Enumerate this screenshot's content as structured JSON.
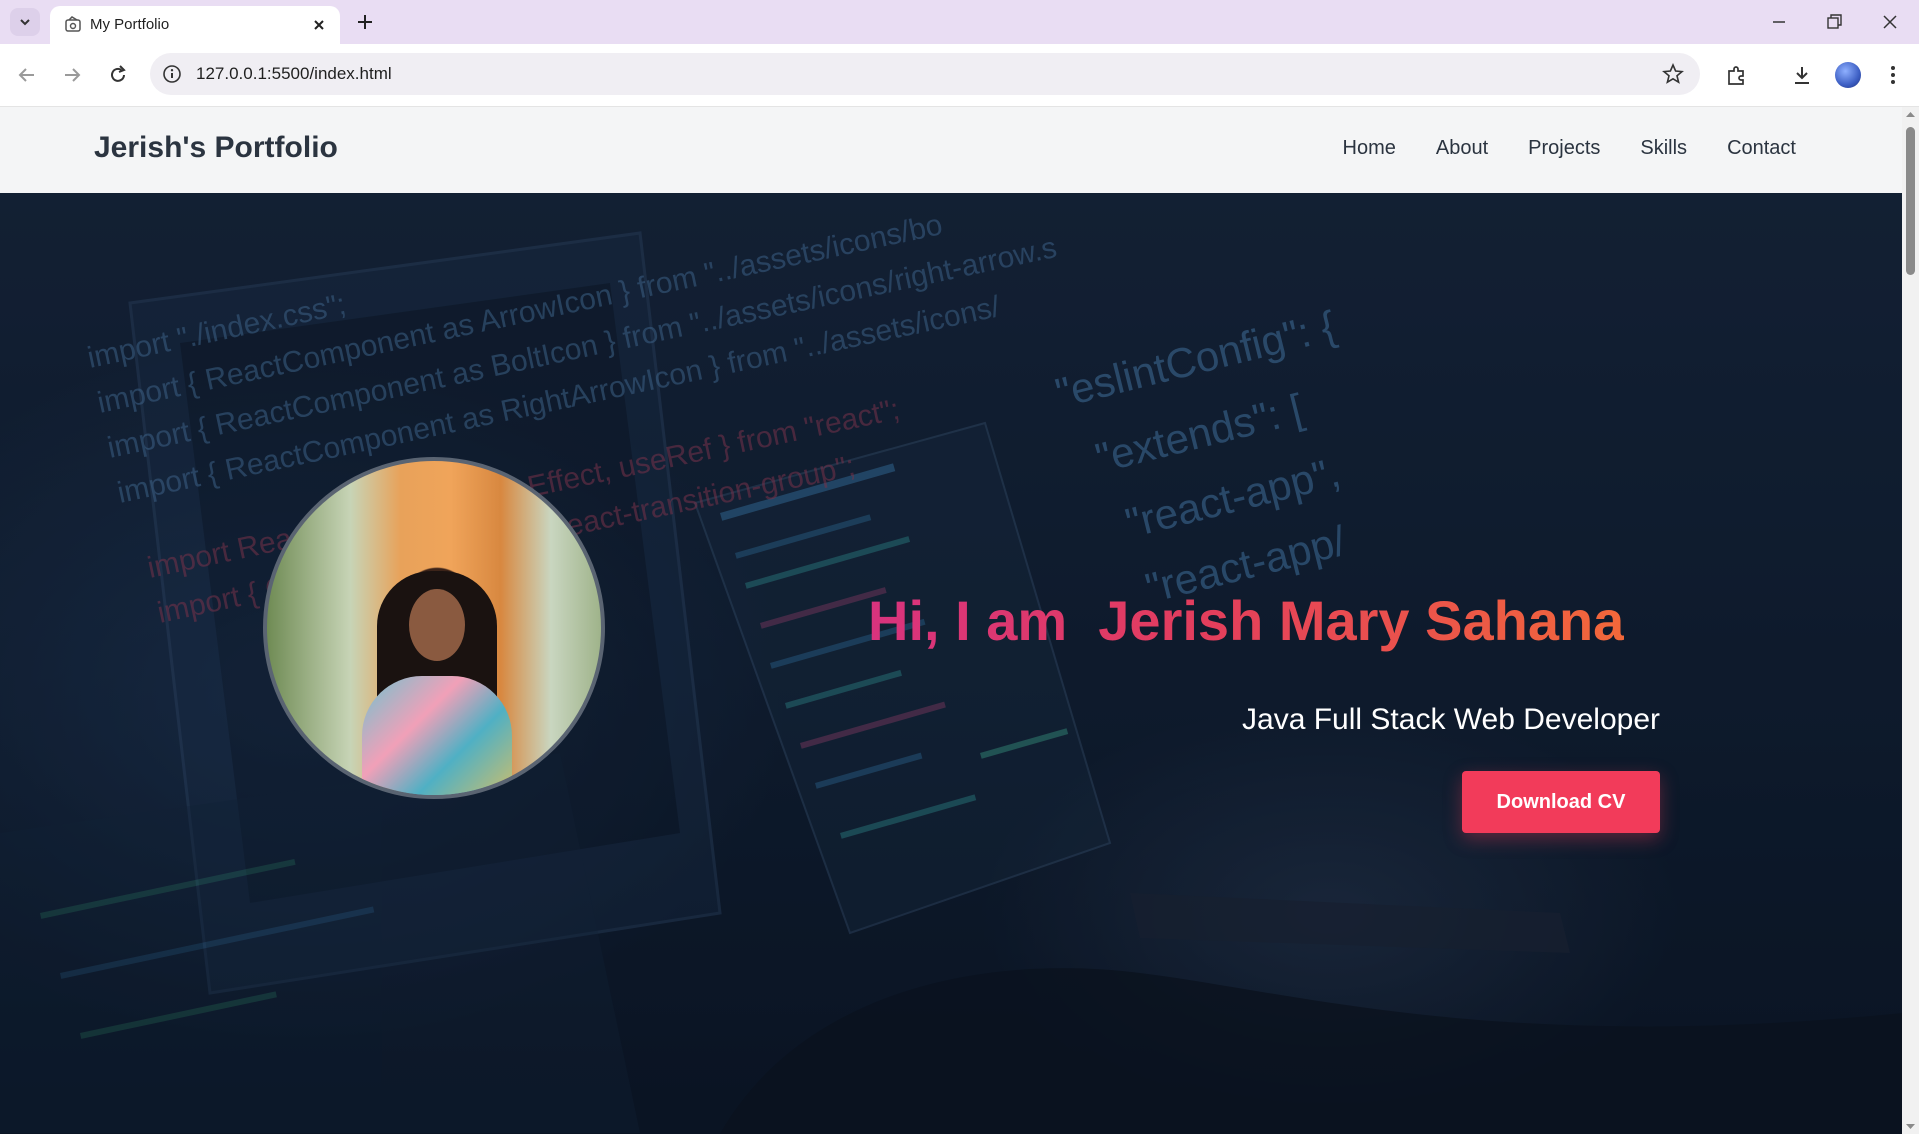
{
  "browser": {
    "tab_title": "My Portfolio",
    "url": "127.0.0.1:5500/index.html"
  },
  "site": {
    "brand": "Jerish's Portfolio",
    "nav": [
      "Home",
      "About",
      "Projects",
      "Skills",
      "Contact"
    ]
  },
  "hero": {
    "greeting": "Hi, I am  Jerish Mary Sahana",
    "role": "Java Full Stack Web Developer",
    "cta": "Download CV",
    "code_lines_left": [
      "import \"./index.css\";",
      "import { ReactComponent as ArrowIcon } from \"../assets/icons/bo",
      "import { ReactComponent as BoltIcon } from \"../assets/icons/right-arrow.s",
      "import { ReactComponent as RightArrowIcon } from \"../assets/icons/",
      "import React, { useState, useEffect, useRef } from \"react\";",
      "import { CSSTransition } from \"react-transition-group\";"
    ],
    "code_lines_right": [
      "\"eslintConfig\": {",
      "\"extends\": [",
      "\"react-app\",",
      "\"react-app/"
    ]
  },
  "colors": {
    "accent": "#f23b5a",
    "gradient_start": "#d8337e",
    "gradient_end": "#f2683a"
  }
}
